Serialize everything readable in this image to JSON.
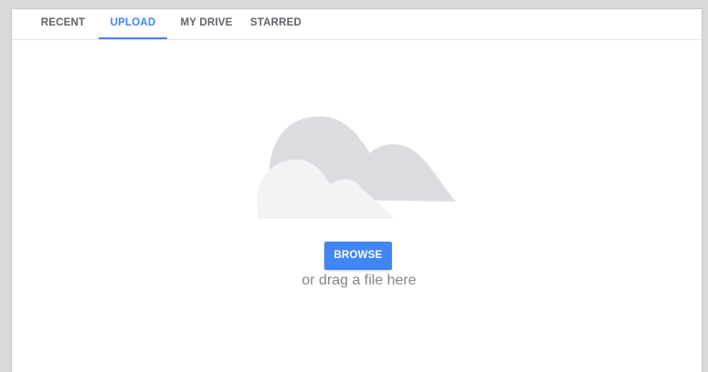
{
  "tabs": [
    {
      "label": "RECENT",
      "active": false
    },
    {
      "label": "UPLOAD",
      "active": true
    },
    {
      "label": "MY DRIVE",
      "active": false
    },
    {
      "label": "STARRED",
      "active": false
    }
  ],
  "upload": {
    "illustration_icon": "cloud-icon",
    "browse_label": "BROWSE",
    "drag_hint": "or drag a file here"
  },
  "colors": {
    "accent": "#4285f4",
    "tab_text": "#5f6368",
    "hint_text": "#80868b",
    "cloud_back": "#dadce0",
    "cloud_front": "#f1f3f4"
  }
}
